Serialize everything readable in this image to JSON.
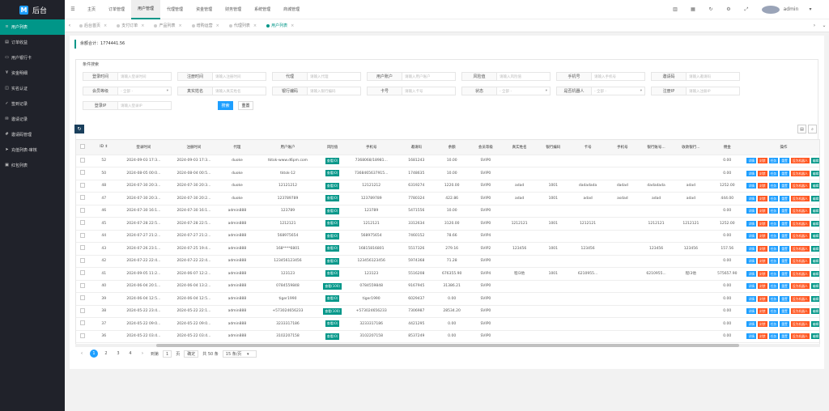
{
  "logo": {
    "mark": "M",
    "text": "后台"
  },
  "sidebar": {
    "items": [
      {
        "label": "用户列表",
        "icon": "bars-icon"
      },
      {
        "label": "订单收益",
        "icon": "doc-icon"
      },
      {
        "label": "用户银行卡",
        "icon": "card-icon"
      },
      {
        "label": "资金明细",
        "icon": "money-icon"
      },
      {
        "label": "实名认证",
        "icon": "id-icon"
      },
      {
        "label": "签到记录",
        "icon": "check-icon"
      },
      {
        "label": "邀请记录",
        "icon": "invite-icon"
      },
      {
        "label": "邀请码管理",
        "icon": "code-icon"
      },
      {
        "label": "充值列表-审核",
        "icon": "arrow-icon"
      },
      {
        "label": "红包列表",
        "icon": "gift-icon"
      }
    ]
  },
  "topbar": {
    "menu": [
      "主页",
      "订单管理",
      "用户管理",
      "代理管理",
      "资金管理",
      "财务管理",
      "系统管理",
      "商城管理"
    ],
    "active_menu": 2,
    "user": "admin"
  },
  "tabs": [
    "后台首页",
    "支付订单",
    "产品列表",
    "增购运营",
    "代理列表",
    "用户列表"
  ],
  "active_tab": 5,
  "amount_label": "余额合计：1774441.56",
  "filter": {
    "title": "条件搜索",
    "rows": [
      [
        {
          "label": "登录时间",
          "ph": "请输入登录时间"
        },
        {
          "label": "注册时间",
          "ph": "请输入注册时间"
        },
        {
          "label": "代理",
          "ph": "请输入代理"
        },
        {
          "label": "用户账户",
          "ph": "请输入用户账户"
        },
        {
          "label": "风险值",
          "ph": "请输入风险值"
        },
        {
          "label": "手机号",
          "ph": "请输入手机号"
        },
        {
          "label": "邀请码",
          "ph": "请输入邀请码"
        }
      ],
      [
        {
          "label": "会员等级",
          "ph": "- 全部 -",
          "select": true
        },
        {
          "label": "真实姓名",
          "ph": "请输入真实姓名"
        },
        {
          "label": "银行编码",
          "ph": "请输入银行编码"
        },
        {
          "label": "卡号",
          "ph": "请输入卡号"
        },
        {
          "label": "状态",
          "ph": "- 全部 -",
          "select": true
        },
        {
          "label": "是否机器人",
          "ph": "- 全部 -",
          "select": true
        },
        {
          "label": "注册IP",
          "ph": "请输入注册IP"
        }
      ],
      [
        {
          "label": "登录IP",
          "ph": "请输入登录IP"
        }
      ]
    ],
    "search": "搜索",
    "reset": "重置"
  },
  "table": {
    "headers": [
      "",
      "ID ⇕",
      "登录时间",
      "注册时间",
      "代理",
      "用户账户",
      "风险值",
      "手机号",
      "邀请码",
      "余额",
      "会员等级",
      "真实姓名",
      "银行编码",
      "卡号",
      "手机号",
      "银行账号...",
      "收款银行...",
      "佣金",
      "操作"
    ],
    "ops": [
      "详情",
      "封禁",
      "任务",
      "重置",
      "设为机器人",
      "编辑"
    ],
    "rows": [
      [
        "52",
        "2024-09-03 17:3...",
        "2024-09-03 17:3...",
        "duoke",
        "tktok-www.d6pm.com",
        "查看(0)",
        "7368068/18981...",
        "1681243",
        "10.00",
        "SVIP0",
        "",
        "",
        "",
        "",
        "",
        "",
        "0.00"
      ],
      [
        "50",
        "2024-08-05 00:0...",
        "2024-08-04 00:5...",
        "duoke",
        "tktok-12",
        "查看(0)",
        "7368465637915...",
        "1748635",
        "10.00",
        "SVIP0",
        "",
        "",
        "",
        "",
        "",
        "",
        "0.00"
      ],
      [
        "48",
        "2024-07-30 20:3...",
        "2024-07-30 20:3...",
        "duoke",
        "12121212",
        "查看(0)",
        "12121212",
        "6319274",
        "1220.00",
        "SVIP0",
        "adad",
        "1001",
        "dadadada",
        "dadad",
        "dadadada",
        "adad",
        "1252.00"
      ],
      [
        "47",
        "2024-07-30 20:3...",
        "2024-07-30 20:2...",
        "duoke",
        "123789789",
        "查看(0)",
        "123789789",
        "7780324",
        "422.86",
        "SVIP0",
        "adad",
        "1001",
        "adad",
        "asdad",
        "adad",
        "adad",
        "444.00"
      ],
      [
        "46",
        "2024-07-30 16:1...",
        "2024-07-30 16:1...",
        "admin888",
        "123789",
        "查看(0)",
        "123789",
        "5471556",
        "10.00",
        "SVIP0",
        "",
        "",
        "",
        "",
        "",
        "",
        "0.00"
      ],
      [
        "45",
        "2024-07-28 22:5...",
        "2024-07-28 22:5...",
        "admin888",
        "1212121",
        "查看(0)",
        "1212121",
        "3312634",
        "3120.00",
        "SVIP0",
        "1212121",
        "1001",
        "1212121",
        "",
        "1212121",
        "1212121",
        "1252.00"
      ],
      [
        "44",
        "2024-07-27 21:2...",
        "2024-07-27 21:2...",
        "admin888",
        "568975654",
        "查看(0)",
        "568975654",
        "7460152",
        "78.66",
        "SVIP4",
        "",
        "",
        "",
        "",
        "",
        "",
        "0.00"
      ],
      [
        "43",
        "2024-07-26 23:1...",
        "2024-07-25 19:4...",
        "admin888",
        "168****6801",
        "查看(0)",
        "16815816801",
        "5517326",
        "279.16",
        "SVIP2",
        "123456",
        "1001",
        "123456",
        "",
        "123456",
        "123456",
        "157.56"
      ],
      [
        "42",
        "2024-07-22 22:4...",
        "2024-07-22 22:4...",
        "admin888",
        "123456123456",
        "查看(0)",
        "123456123456",
        "5974368",
        "71.28",
        "SVIP0",
        "",
        "",
        "",
        "",
        "",
        "",
        "0.00"
      ],
      [
        "41",
        "2024-09-05 11:2...",
        "2024-06-07 12:2...",
        "admin888",
        "123123",
        "查看(0)",
        "123123",
        "5516208",
        "676355.90",
        "SVIP4",
        "程l3他",
        "1001",
        "6210955...",
        "",
        "6210955...",
        "程l3他",
        "575657.90"
      ],
      [
        "40",
        "2024-06-04 20:1...",
        "2024-06-04 13:2...",
        "admin888",
        "0784559848",
        "查看(100)",
        "0784559848",
        "9167945",
        "31386.21",
        "SVIP0",
        "",
        "",
        "",
        "",
        "",
        "",
        "0.00"
      ],
      [
        "39",
        "2024-06-04 12:5...",
        "2024-06-04 12:5...",
        "admin888",
        "tiger1990",
        "查看(0)",
        "tiger1990",
        "6029437",
        "0.00",
        "SVIP0",
        "",
        "",
        "",
        "",
        "",
        "",
        "0.00"
      ],
      [
        "38",
        "2024-05-22 23:4...",
        "2024-05-22 22:1...",
        "admin888",
        "+573024656233",
        "查看(100)",
        "+573024656233",
        "7306987",
        "28534.20",
        "SVIP0",
        "",
        "",
        "",
        "",
        "",
        "",
        "0.00"
      ],
      [
        "37",
        "2024-05-22 09:0...",
        "2024-05-22 09:0...",
        "admin888",
        "3233317186",
        "查看(0)",
        "3233317186",
        "4421295",
        "0.00",
        "SVIP0",
        "",
        "",
        "",
        "",
        "",
        "",
        "0.00"
      ],
      [
        "36",
        "2024-05-22 03:4...",
        "2024-05-22 03:4...",
        "admin888",
        "3102207158",
        "查看(0)",
        "3102207158",
        "8537249",
        "0.00",
        "SVIP0",
        "",
        "",
        "",
        "",
        "",
        "",
        "0.00"
      ]
    ]
  },
  "pager": {
    "pages": [
      "1",
      "2",
      "3",
      "4"
    ],
    "current": "1",
    "goto_label": "到第",
    "goto_value": "1",
    "page_unit": "页",
    "confirm": "确定",
    "total": "共 50 条",
    "per_page": "15 条/页"
  }
}
